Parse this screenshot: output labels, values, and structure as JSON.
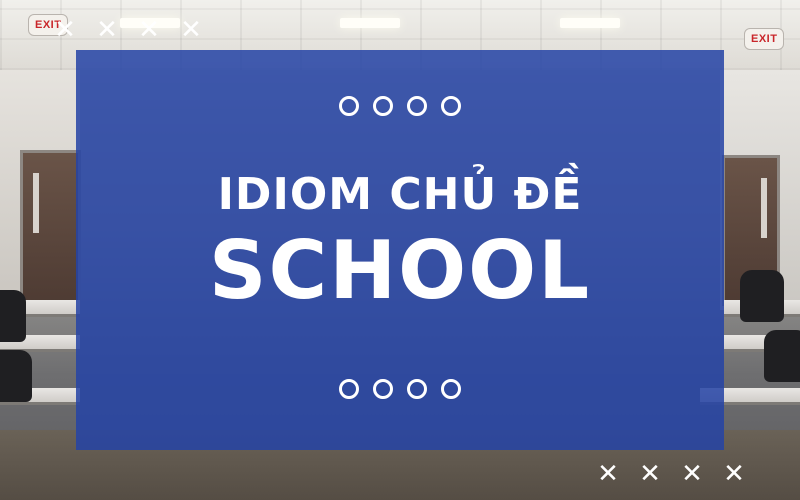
{
  "background": {
    "exit_sign_left": "EXIT",
    "exit_sign_right": "EXIT"
  },
  "decorations": {
    "x_marks_top_left": [
      "✕",
      "✕",
      "✕",
      "✕"
    ],
    "x_marks_bottom_right": [
      "✕",
      "✕",
      "✕",
      "✕"
    ],
    "circle_count_top": 4,
    "circle_count_bottom": 4
  },
  "title": {
    "line1": "IDIOM CHỦ ĐỀ",
    "line2": "SCHOOL"
  },
  "colors": {
    "panel": "#2543a5",
    "text": "#ffffff",
    "exit": "#c9262a"
  }
}
